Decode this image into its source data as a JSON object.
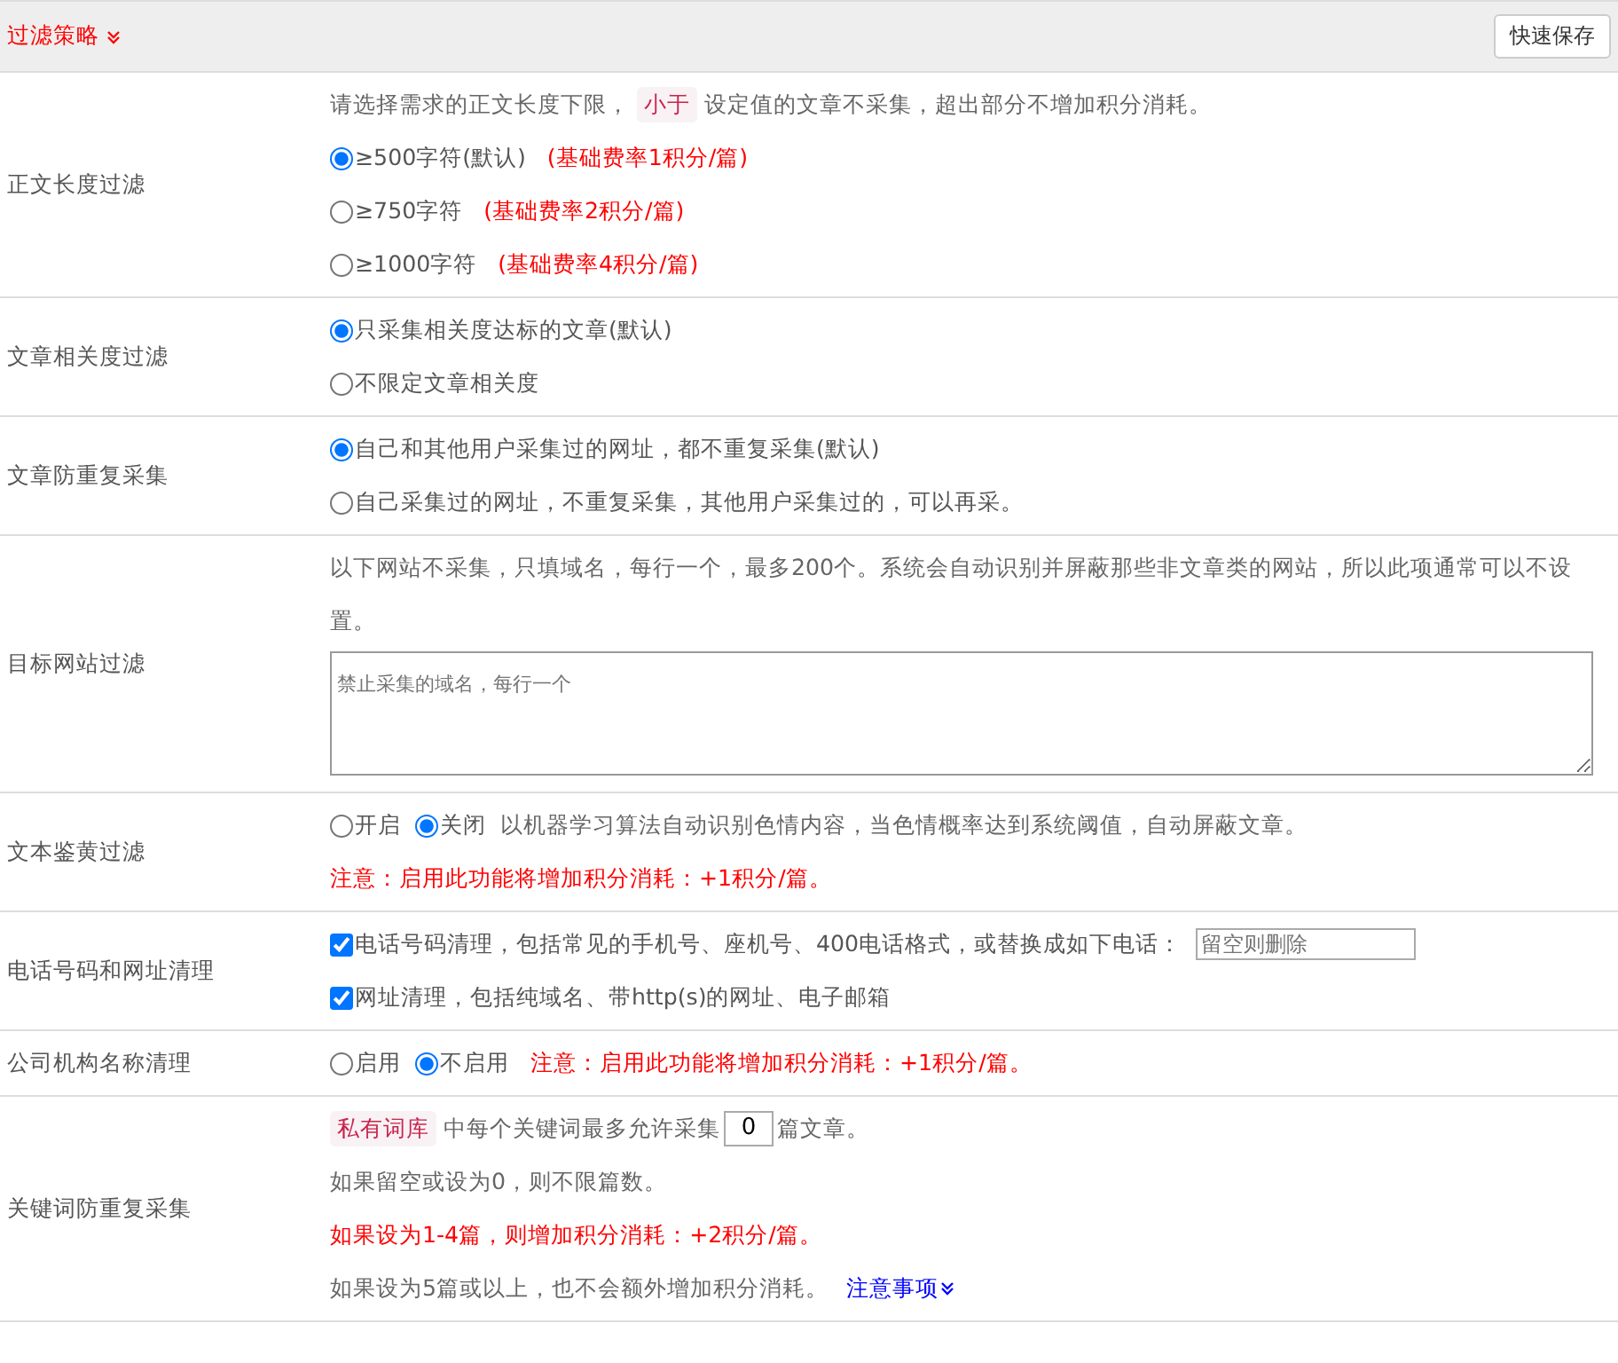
{
  "header": {
    "title": "过滤策略",
    "save_button": "快速保存"
  },
  "rows": [
    {
      "label": "正文长度过滤",
      "lines": [
        [
          {
            "kind": "text",
            "text": "请选择需求的正文长度下限，"
          },
          {
            "kind": "tag",
            "text": "小于"
          },
          {
            "kind": "text",
            "text": "设定值的文章不采集，超出部分不增加积分消耗。"
          }
        ],
        [
          {
            "kind": "radio",
            "text": "≥500字符(默认)",
            "selected": true
          },
          {
            "kind": "note",
            "text": "(基础费率1积分/篇)"
          }
        ],
        [
          {
            "kind": "radio",
            "text": "≥750字符",
            "selected": false
          },
          {
            "kind": "note",
            "text": "(基础费率2积分/篇)"
          }
        ],
        [
          {
            "kind": "radio",
            "text": "≥1000字符",
            "selected": false
          },
          {
            "kind": "note",
            "text": "(基础费率4积分/篇)"
          }
        ]
      ]
    },
    {
      "label": "文章相关度过滤",
      "lines": [
        [
          {
            "kind": "radio",
            "text": "只采集相关度达标的文章(默认)",
            "selected": true
          }
        ],
        [
          {
            "kind": "radio",
            "text": "不限定文章相关度",
            "selected": false
          }
        ]
      ]
    },
    {
      "label": "文章防重复采集",
      "lines": [
        [
          {
            "kind": "radio",
            "text": "自己和其他用户采集过的网址，都不重复采集(默认)",
            "selected": true
          }
        ],
        [
          {
            "kind": "radio",
            "text": "自己采集过的网址，不重复采集，其他用户采集过的，可以再采。",
            "selected": false
          }
        ]
      ]
    },
    {
      "label": "目标网站过滤",
      "lines": [
        [
          {
            "kind": "text",
            "text": "以下网站不采集，只填域名，每行一个，最多200个。系统会自动识别并屏蔽那些非文章类的网站，所以此项通常可以不设置。"
          }
        ],
        [
          {
            "kind": "textarea",
            "placeholder": "禁止采集的域名，每行一个"
          }
        ]
      ]
    },
    {
      "label": "文本鉴黄过滤",
      "lines": [
        [
          {
            "kind": "radio",
            "text": "开启",
            "selected": false
          },
          {
            "kind": "radio",
            "text": "关闭",
            "selected": true
          },
          {
            "kind": "text",
            "text": "以机器学习算法自动识别色情内容，当色情概率达到系统阈值，自动屏蔽文章。"
          }
        ],
        [
          {
            "kind": "note",
            "text": "注意：启用此功能将增加积分消耗：+1积分/篇。"
          }
        ]
      ]
    },
    {
      "label": "电话号码和网址清理",
      "lines": [
        [
          {
            "kind": "checkbox",
            "text": "电话号码清理，包括常见的手机号、座机号、400电话格式，或替换成如下电话：",
            "checked": true
          },
          {
            "kind": "field",
            "placeholder": "留空则删除"
          }
        ],
        [
          {
            "kind": "checkbox",
            "text": "网址清理，包括纯域名、带http(s)的网址、电子邮箱",
            "checked": true
          }
        ]
      ]
    },
    {
      "label": "公司机构名称清理",
      "lines": [
        [
          {
            "kind": "radio",
            "text": "启用",
            "selected": false
          },
          {
            "kind": "radio",
            "text": "不启用",
            "selected": true
          },
          {
            "kind": "note",
            "text": "注意：启用此功能将增加积分消耗：+1积分/篇。"
          }
        ]
      ]
    },
    {
      "label": "关键词防重复采集",
      "lines": [
        [
          {
            "kind": "tag",
            "text": "私有词库"
          },
          {
            "kind": "text",
            "text": "中每个关键词最多允许采集"
          },
          {
            "kind": "number",
            "value": "0"
          },
          {
            "kind": "text",
            "text": "篇文章。"
          }
        ],
        [
          {
            "kind": "text",
            "text": "如果留空或设为0，则不限篇数。"
          }
        ],
        [
          {
            "kind": "note",
            "text": "如果设为1-4篇，则增加积分消耗：+2积分/篇。"
          }
        ],
        [
          {
            "kind": "text",
            "text": "如果设为5篇或以上，也不会额外增加积分消耗。"
          },
          {
            "kind": "link",
            "text": "注意事项"
          }
        ]
      ]
    }
  ]
}
